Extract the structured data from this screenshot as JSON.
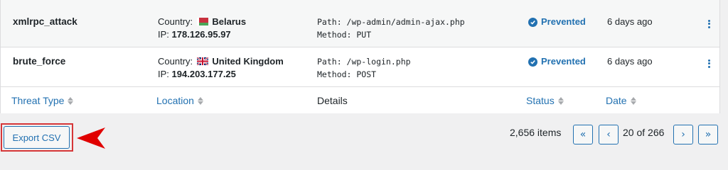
{
  "rows": [
    {
      "threat": "xmlrpc_attack",
      "country_label": "Country:",
      "country": "Belarus",
      "ip_label": "IP:",
      "ip": "178.126.95.97",
      "path": "Path: /wp-admin/admin-ajax.php",
      "method": "Method: PUT",
      "status": "Prevented",
      "date": "6 days ago"
    },
    {
      "threat": "brute_force",
      "country_label": "Country:",
      "country": "United Kingdom",
      "ip_label": "IP:",
      "ip": "194.203.177.25",
      "path": "Path: /wp-login.php",
      "method": "Method: POST",
      "status": "Prevented",
      "date": "6 days ago"
    }
  ],
  "columns": {
    "threat_type": "Threat Type",
    "location": "Location",
    "details": "Details",
    "status": "Status",
    "date": "Date"
  },
  "footer": {
    "export_label": "Export CSV",
    "items_count": "2,656 items",
    "first_page": "«",
    "prev_page": "‹",
    "page_info": "20 of 266",
    "next_page": "›",
    "last_page": "»"
  },
  "colors": {
    "accent": "#2271b1",
    "highlight": "#d63638",
    "border": "#dcdcde"
  },
  "icons": {
    "status": "check-circle-icon",
    "row_actions": "vertical-dots-icon",
    "sort": "sort-arrows-icon",
    "annotation": "red-arrow-icon"
  }
}
